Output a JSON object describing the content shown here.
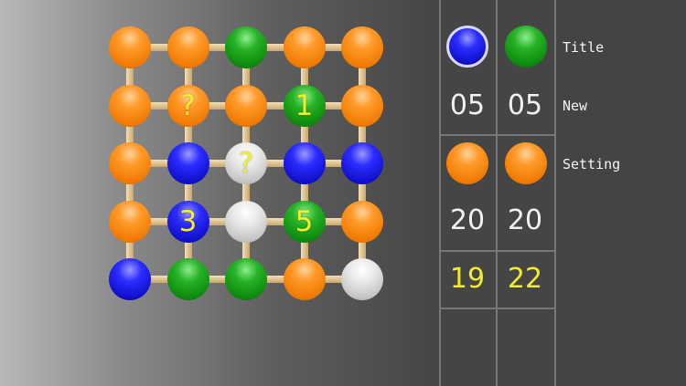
{
  "board": {
    "rows": [
      [
        {
          "color": "orange",
          "label": ""
        },
        {
          "color": "orange",
          "label": ""
        },
        {
          "color": "green",
          "label": ""
        },
        {
          "color": "orange",
          "label": ""
        },
        {
          "color": "orange",
          "label": ""
        }
      ],
      [
        {
          "color": "orange",
          "label": ""
        },
        {
          "color": "orange",
          "label": "?"
        },
        {
          "color": "orange",
          "label": ""
        },
        {
          "color": "green",
          "label": "1"
        },
        {
          "color": "orange",
          "label": ""
        }
      ],
      [
        {
          "color": "orange",
          "label": ""
        },
        {
          "color": "blue",
          "label": ""
        },
        {
          "color": "white",
          "label": "?"
        },
        {
          "color": "blue",
          "label": ""
        },
        {
          "color": "blue",
          "label": ""
        }
      ],
      [
        {
          "color": "orange",
          "label": ""
        },
        {
          "color": "blue",
          "label": "3"
        },
        {
          "color": "white",
          "label": ""
        },
        {
          "color": "green",
          "label": "5"
        },
        {
          "color": "orange",
          "label": ""
        }
      ],
      [
        {
          "color": "blue",
          "label": ""
        },
        {
          "color": "green",
          "label": ""
        },
        {
          "color": "green",
          "label": ""
        },
        {
          "color": "orange",
          "label": ""
        },
        {
          "color": "white",
          "label": ""
        }
      ]
    ]
  },
  "panel": {
    "player1": {
      "ball_color": "blue",
      "count": "05",
      "total": "20",
      "score": "19"
    },
    "player2": {
      "ball_color": "green",
      "count": "05",
      "total": "20",
      "score": "22"
    },
    "row2_balls": [
      "orange",
      "orange"
    ]
  },
  "menu": {
    "title": "Title",
    "new": "New",
    "setting": "Setting"
  },
  "colors": {
    "orange": "#f07a00",
    "green": "#0d8a0d",
    "blue": "#1010cc",
    "white": "#c4c4c4",
    "score": "#f0ee2a"
  }
}
